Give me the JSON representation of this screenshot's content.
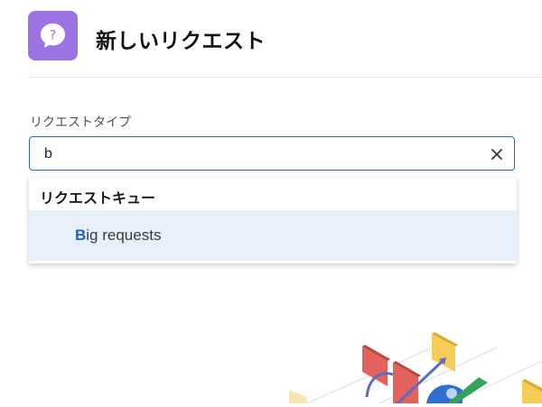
{
  "header": {
    "title": "新しいリクエスト",
    "icon": "help-bubble-icon",
    "icon_color": "#9c73e3"
  },
  "form": {
    "field_label": "リクエストタイプ",
    "input_value": "b",
    "clear_icon": "close-icon",
    "border_color": "#2c6bb2"
  },
  "dropdown": {
    "group_label": "リクエストキュー",
    "options": [
      {
        "match": "B",
        "rest": "ig requests"
      }
    ],
    "highlight_bg": "#e8f0fb",
    "match_color": "#1f5fbf"
  },
  "illustration": {
    "icon": "workflow-illustration"
  }
}
